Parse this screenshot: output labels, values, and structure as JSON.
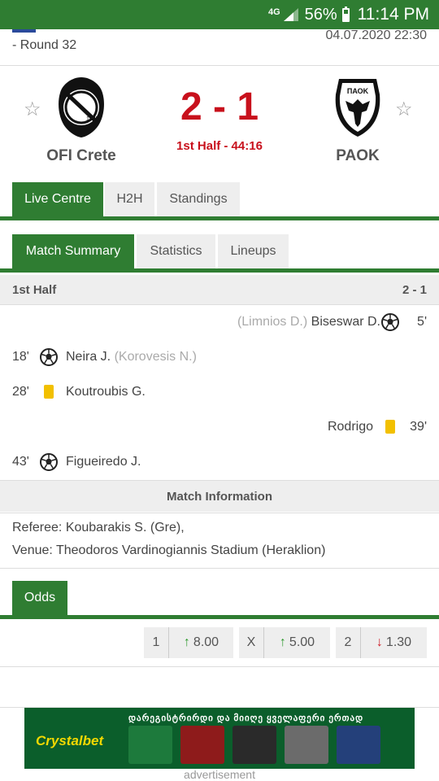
{
  "status_bar": {
    "network": "4G",
    "battery_percent": "56%",
    "time": "11:14 PM"
  },
  "match_header": {
    "round": "- Round 32",
    "datetime": "04.07.2020 22:30"
  },
  "home_team": {
    "name": "OFI Crete",
    "crest_text": "1925"
  },
  "away_team": {
    "name": "PAOK",
    "crest_text": "ΠΑΟΚ"
  },
  "score": "2 - 1",
  "match_status": "1st Half - 44:16",
  "main_tabs": [
    "Live Centre",
    "H2H",
    "Standings"
  ],
  "sub_tabs": [
    "Match Summary",
    "Statistics",
    "Lineups"
  ],
  "summary": {
    "period_label": "1st Half",
    "period_score": "2 - 1",
    "events": [
      {
        "side": "away",
        "type": "goal",
        "minute": "5'",
        "player": "Biseswar D.",
        "assist": "(Limnios D.)"
      },
      {
        "side": "home",
        "type": "goal",
        "minute": "18'",
        "player": "Neira J.",
        "assist": "(Korovesis N.)"
      },
      {
        "side": "home",
        "type": "yellow-card",
        "minute": "28'",
        "player": "Koutroubis G.",
        "assist": ""
      },
      {
        "side": "away",
        "type": "yellow-card",
        "minute": "39'",
        "player": "Rodrigo",
        "assist": ""
      },
      {
        "side": "home",
        "type": "goal",
        "minute": "43'",
        "player": "Figueiredo J.",
        "assist": ""
      }
    ]
  },
  "match_information": {
    "title": "Match Information",
    "referee": "Referee: Koubarakis S. (Gre),",
    "venue": "Venue: Theodoros Vardinogiannis Stadium (Heraklion)"
  },
  "odds": {
    "tab_label": "Odds",
    "items": [
      {
        "label": "1",
        "value": "8.00",
        "trend": "up"
      },
      {
        "label": "X",
        "value": "5.00",
        "trend": "up"
      },
      {
        "label": "2",
        "value": "1.30",
        "trend": "down"
      }
    ]
  },
  "ad": {
    "brand": "Crystalbet",
    "headline": "დარეგისტრირდი და მიიღე ყველაფერი ერთად",
    "label": "advertisement"
  },
  "colors": {
    "brand_green": "#2f7d32",
    "score_red": "#c8101c",
    "card_yellow": "#f2c000"
  }
}
